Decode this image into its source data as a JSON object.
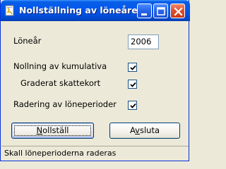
{
  "window": {
    "title": "Nollställning av löneåret",
    "minimize_glyph": "_",
    "maximize_glyph": "□",
    "close_glyph": "×"
  },
  "form": {
    "year_label": "Löneår",
    "year_value": "2006",
    "options": [
      {
        "label": "Nollning av kumulativa",
        "checked": true
      },
      {
        "label": "Graderat skattekort",
        "checked": true
      },
      {
        "label": "Radering av löneperioder",
        "checked": true
      }
    ]
  },
  "buttons": {
    "reset_label": "Nollställ",
    "reset_accesskey": "N",
    "reset_rest": "ollställ",
    "quit_label": "Avsluta",
    "quit_prefix": "A",
    "quit_accesskey": "v",
    "quit_rest": "sluta"
  },
  "statusbar": {
    "text": "Skall löneperioderna raderas"
  },
  "colors": {
    "titlebar": "#0058ee",
    "face": "#ece9d8",
    "checkmark": "#21a121"
  }
}
